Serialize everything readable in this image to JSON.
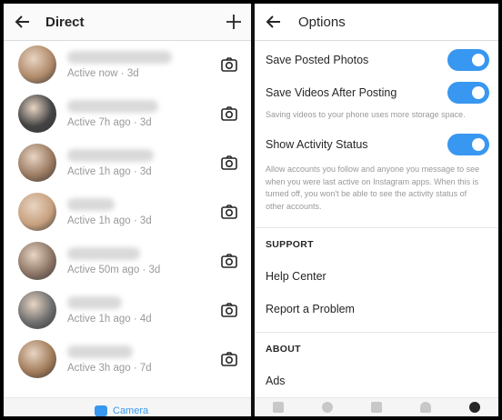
{
  "left": {
    "title": "Direct",
    "conversations": [
      {
        "status": "Active now · 3d",
        "avatar_color": "#b08a6a"
      },
      {
        "status": "Active 7h ago · 3d",
        "avatar_color": "#444444"
      },
      {
        "status": "Active 1h ago · 3d",
        "avatar_color": "#9b7b62"
      },
      {
        "status": "Active 1h ago · 3d",
        "avatar_color": "#c7a07e"
      },
      {
        "status": "Active 50m ago · 3d",
        "avatar_color": "#8d7666"
      },
      {
        "status": "Active 1h ago · 4d",
        "avatar_color": "#6e6e6e"
      },
      {
        "status": "Active 3h ago · 7d",
        "avatar_color": "#a37d5c"
      }
    ],
    "camera_tab_label": "Camera"
  },
  "right": {
    "title": "Options",
    "save_posted_photos": "Save Posted Photos",
    "save_videos": "Save Videos After Posting",
    "save_videos_help": "Saving videos to your phone uses more storage space.",
    "activity_status": "Show Activity Status",
    "activity_help": "Allow accounts you follow and anyone you message to see when you were last active on Instagram apps. When this is turned off, you won't be able to see the activity status of other accounts.",
    "support_header": "SUPPORT",
    "help_center": "Help Center",
    "report_problem": "Report a Problem",
    "about_header": "ABOUT",
    "ads": "Ads"
  },
  "colors": {
    "accent": "#3897f0",
    "text": "#262626",
    "muted": "#999999"
  }
}
